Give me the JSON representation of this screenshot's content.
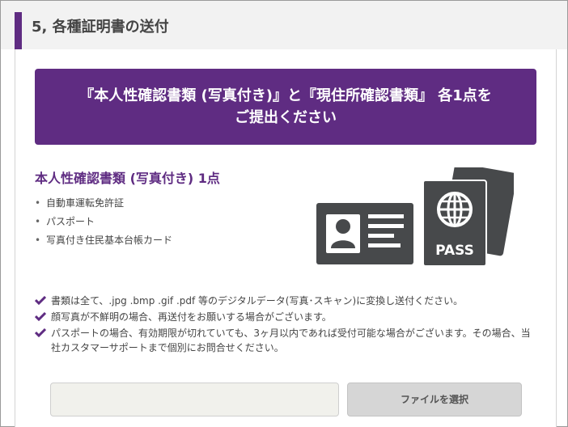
{
  "section": {
    "title": "5, 各種証明書の送付"
  },
  "banner": {
    "line1": "『本人性確認書類 (写真付き)』と『現住所確認書類』 各1点を",
    "line2": "ご提出ください"
  },
  "identity": {
    "heading": "本人性確認書類 (写真付き) 1点",
    "items": [
      "自動車運転免許証",
      "パスポート",
      "写真付き住民基本台帳カード"
    ],
    "passport_label": "PASS"
  },
  "notes": [
    "書類は全て、.jpg .bmp .gif .pdf 等のデジタルデータ(写真･スキャン)に変換し送付ください。",
    "顔写真が不鮮明の場合、再送付をお願いする場合がございます。",
    "パスポートの場合、有効期限が切れていても、3ヶ月以内であれば受付可能な場合がございます。その場合、当社カスタマーサポートまで個別にお問合せください。"
  ],
  "upload": {
    "file_value": "",
    "button_label": "ファイルを選択"
  },
  "colors": {
    "accent": "#5f2c82",
    "icon": "#47494b"
  }
}
